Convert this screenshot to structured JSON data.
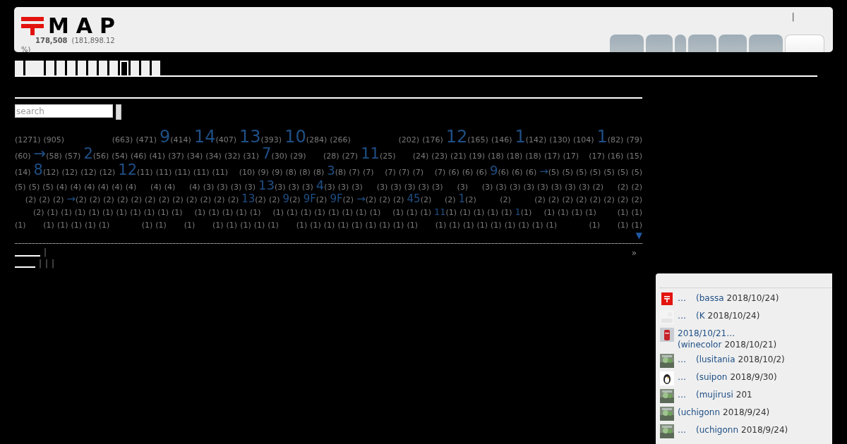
{
  "header": {
    "logo": "MAP",
    "stats": {
      "count": "178,508",
      "total": "(181,898.12",
      "percent": "%)"
    },
    "top_link": "|",
    "tabs": [
      {
        "selected": false
      },
      {
        "selected": false
      },
      {
        "selected": false
      },
      {
        "selected": false
      },
      {
        "selected": false
      },
      {
        "selected": false
      },
      {
        "selected": true
      }
    ]
  },
  "subnav": [
    {
      "selected": false
    },
    {
      "selected": false
    },
    {
      "selected": false
    },
    {
      "selected": false
    },
    {
      "selected": false
    },
    {
      "selected": false
    },
    {
      "selected": false
    },
    {
      "selected": false
    },
    {
      "selected": false
    },
    {
      "selected": true
    },
    {
      "selected": false
    },
    {
      "selected": false
    },
    {
      "selected": false
    }
  ],
  "search": {
    "placeholder": "search"
  },
  "tag_rows": [
    [
      {
        "count": "(1271)"
      },
      {
        "count": "(905)"
      },
      {
        "kind": "gap"
      },
      {
        "kind": "gap"
      },
      {
        "kind": "gap"
      },
      {
        "count": "(663)"
      },
      {
        "count": "(471)"
      },
      {
        "kind": "xl",
        "name": "9",
        "count": "(414)"
      },
      {
        "kind": "xl",
        "name": "14",
        "count": "(407)"
      },
      {
        "kind": "xl",
        "name": "13",
        "count": "(393)"
      },
      {
        "kind": "xl",
        "name": "10",
        "count": "(284)"
      },
      {
        "count": "(266)"
      },
      {
        "kind": "gap"
      },
      {
        "kind": "gap"
      },
      {
        "kind": "gap"
      },
      {
        "count": "(202)"
      },
      {
        "count": "(176)"
      },
      {
        "kind": "xl",
        "name": "12",
        "count": "(165)"
      },
      {
        "count": "(146)"
      },
      {
        "kind": "xl",
        "name": "1",
        "count": "(142)"
      },
      {
        "count": "(130)"
      },
      {
        "count": "(104)"
      },
      {
        "kind": "xl",
        "name": "1",
        "count": "(82)"
      },
      {
        "count": "(79)"
      }
    ],
    [
      {
        "count": "(60)"
      },
      {
        "kind": "l",
        "name": "→",
        "count": "(58)"
      },
      {
        "count": "(57)"
      },
      {
        "kind": "l",
        "name": "2",
        "count": "(56)"
      },
      {
        "count": "(54)"
      },
      {
        "count": "(46)"
      },
      {
        "count": "(41)"
      },
      {
        "count": "(37)"
      },
      {
        "count": "(34)"
      },
      {
        "count": "(34)"
      },
      {
        "count": "(32)"
      },
      {
        "count": "(31)"
      },
      {
        "kind": "l",
        "name": "7",
        "count": "(30)"
      },
      {
        "count": "(29)"
      },
      {
        "kind": "gap"
      },
      {
        "kind": "gap"
      },
      {
        "count": "(28)"
      },
      {
        "count": "(27)"
      },
      {
        "kind": "l",
        "name": "11",
        "count": "(25)"
      },
      {
        "kind": "gap"
      },
      {
        "kind": "gap"
      },
      {
        "count": "(24)"
      },
      {
        "count": "(23)"
      },
      {
        "count": "(21)"
      },
      {
        "count": "(19)"
      },
      {
        "count": "(18)"
      },
      {
        "count": "(18)"
      },
      {
        "count": "(18)"
      },
      {
        "count": "(17)"
      },
      {
        "count": "(17)"
      },
      {
        "kind": "gap"
      },
      {
        "count": "(17)"
      },
      {
        "count": "(16)"
      },
      {
        "count": "(15)"
      }
    ],
    [
      {
        "count": "(14)"
      },
      {
        "kind": "l",
        "name": "8",
        "count": "(12)"
      },
      {
        "count": "(12)"
      },
      {
        "count": "(12)"
      },
      {
        "count": "(12)"
      },
      {
        "kind": "l",
        "name": "12",
        "count": "(11)"
      },
      {
        "count": "(11)"
      },
      {
        "count": "(11)"
      },
      {
        "count": "(11)"
      },
      {
        "count": "(11)"
      },
      {
        "kind": "gap"
      },
      {
        "count": "(10)"
      },
      {
        "count": "(9)"
      },
      {
        "count": "(9)"
      },
      {
        "count": "(8)"
      },
      {
        "count": "(8)"
      },
      {
        "count": "(8)"
      },
      {
        "kind": "m",
        "name": "3",
        "count": "(8)"
      },
      {
        "count": "(7)"
      },
      {
        "count": "(7)"
      },
      {
        "kind": "gap"
      },
      {
        "count": "(7)"
      },
      {
        "count": "(7)"
      },
      {
        "count": "(7)"
      },
      {
        "kind": "gap"
      },
      {
        "count": "(7)"
      },
      {
        "count": "(6)"
      },
      {
        "count": "(6)"
      },
      {
        "count": "(6)"
      },
      {
        "kind": "m",
        "name": "9",
        "count": "(6)"
      },
      {
        "count": "(6)"
      },
      {
        "count": "(6)"
      },
      {
        "kind": "s",
        "name": "→",
        "count": "(5)"
      },
      {
        "count": "(5)"
      },
      {
        "count": "(5)"
      },
      {
        "count": "(5)"
      },
      {
        "count": "(5)"
      },
      {
        "count": "(5)"
      },
      {
        "count": "(5)"
      }
    ],
    [
      {
        "count": "(5)"
      },
      {
        "count": "(5)"
      },
      {
        "count": "(5)"
      },
      {
        "count": "(4)"
      },
      {
        "count": "(4)"
      },
      {
        "count": "(4)"
      },
      {
        "count": "(4)"
      },
      {
        "count": "(4)"
      },
      {
        "count": "(4)"
      },
      {
        "kind": "gap"
      },
      {
        "count": "(4)"
      },
      {
        "count": "(4)"
      },
      {
        "kind": "gap"
      },
      {
        "count": "(4)"
      },
      {
        "count": "(3)"
      },
      {
        "count": "(3)"
      },
      {
        "count": "(3)"
      },
      {
        "count": "(3)"
      },
      {
        "kind": "m",
        "name": "13",
        "count": "(3)"
      },
      {
        "count": "(3)"
      },
      {
        "count": "(3)"
      },
      {
        "kind": "m",
        "name": "4",
        "count": "(3)"
      },
      {
        "count": "(3)"
      },
      {
        "count": "(3)"
      },
      {
        "kind": "gap"
      },
      {
        "count": "(3)"
      },
      {
        "count": "(3)"
      },
      {
        "count": "(3)"
      },
      {
        "count": "(3)"
      },
      {
        "count": "(3)"
      },
      {
        "kind": "gap"
      },
      {
        "count": "(3)"
      },
      {
        "kind": "gap"
      },
      {
        "count": "(3)"
      },
      {
        "count": "(3)"
      },
      {
        "count": "(3)"
      },
      {
        "count": "(3)"
      },
      {
        "count": "(3)"
      },
      {
        "count": "(3)"
      },
      {
        "count": "(3)"
      },
      {
        "count": "(3)"
      },
      {
        "count": "(2)"
      },
      {
        "kind": "gap"
      },
      {
        "count": "(2)"
      },
      {
        "count": "(2)"
      }
    ],
    [
      {
        "kind": "gap"
      },
      {
        "count": "(2)"
      },
      {
        "count": "(2)"
      },
      {
        "count": "(2)"
      },
      {
        "kind": "s",
        "name": "→",
        "count": "(2)"
      },
      {
        "count": "(2)"
      },
      {
        "count": "(2)"
      },
      {
        "count": "(2)"
      },
      {
        "count": "(2)"
      },
      {
        "count": "(2)"
      },
      {
        "count": "(2)"
      },
      {
        "count": "(2)"
      },
      {
        "count": "(2)"
      },
      {
        "count": "(2)"
      },
      {
        "count": "(2)"
      },
      {
        "count": "(2)"
      },
      {
        "kind": "s",
        "name": "13",
        "count": "(2)"
      },
      {
        "count": "(2)"
      },
      {
        "kind": "s",
        "name": "9",
        "count": "(2)"
      },
      {
        "kind": "s",
        "name": "9F",
        "count": "(2)"
      },
      {
        "kind": "s",
        "name": "9F",
        "count": "(2)"
      },
      {
        "kind": "s",
        "name": "→",
        "count": "(2)"
      },
      {
        "count": "(2)"
      },
      {
        "count": "(2)"
      },
      {
        "kind": "s",
        "name": "45",
        "count": "(2)"
      },
      {
        "kind": "gap"
      },
      {
        "count": "(2)"
      },
      {
        "kind": "s",
        "name": "1",
        "count": "(2)"
      },
      {
        "kind": "gap"
      },
      {
        "kind": "gap"
      },
      {
        "count": "(2)"
      },
      {
        "kind": "gap"
      },
      {
        "kind": "gap"
      },
      {
        "count": "(2)"
      },
      {
        "count": "(2)"
      },
      {
        "count": "(2)"
      },
      {
        "count": "(2)"
      },
      {
        "count": "(2)"
      },
      {
        "count": "(2)"
      },
      {
        "count": "(2)"
      },
      {
        "count": "(2)"
      }
    ],
    [
      {
        "kind": "gap"
      },
      {
        "kind": "gap"
      },
      {
        "count": "(2)"
      },
      {
        "count": "(1)"
      },
      {
        "count": "(1)"
      },
      {
        "count": "(1)"
      },
      {
        "count": "(1)"
      },
      {
        "count": "(1)"
      },
      {
        "count": "(1)"
      },
      {
        "count": "(1)"
      },
      {
        "count": "(1)"
      },
      {
        "count": "(1)"
      },
      {
        "count": "(1)"
      },
      {
        "kind": "gap"
      },
      {
        "count": "(1)"
      },
      {
        "count": "(1)"
      },
      {
        "count": "(1)"
      },
      {
        "count": "(1)"
      },
      {
        "count": "(1)"
      },
      {
        "kind": "gap"
      },
      {
        "count": "(1)"
      },
      {
        "count": "(1)"
      },
      {
        "count": "(1)"
      },
      {
        "count": "(1)"
      },
      {
        "count": "(1)"
      },
      {
        "count": "(1)"
      },
      {
        "count": "(1)"
      },
      {
        "count": "(1)"
      },
      {
        "kind": "gap"
      },
      {
        "count": "(1)"
      },
      {
        "count": "(1)"
      },
      {
        "count": "(1)"
      },
      {
        "kind": "xs",
        "name": "11",
        "count": "(1)"
      },
      {
        "count": "(1)"
      },
      {
        "count": "(1)"
      },
      {
        "count": "(1)"
      },
      {
        "count": "(1)"
      },
      {
        "kind": "xs",
        "name": "1",
        "count": "(1)"
      },
      {
        "kind": "gap"
      },
      {
        "count": "(1)"
      },
      {
        "count": "(1)"
      },
      {
        "count": "(1)"
      },
      {
        "count": "(1)"
      },
      {
        "kind": "gap"
      },
      {
        "kind": "gap"
      },
      {
        "count": "(1)"
      },
      {
        "count": "(1)"
      }
    ],
    [
      {
        "count": "(1)"
      },
      {
        "kind": "gap"
      },
      {
        "count": "(1)"
      },
      {
        "count": "(1)"
      },
      {
        "count": "(1)"
      },
      {
        "count": "(1)"
      },
      {
        "count": "(1)"
      },
      {
        "kind": "gap"
      },
      {
        "kind": "gap"
      },
      {
        "count": "(1)"
      },
      {
        "count": "(1)"
      },
      {
        "kind": "gap"
      },
      {
        "count": "(1)"
      },
      {
        "kind": "gap"
      },
      {
        "count": "(1)"
      },
      {
        "count": "(1)"
      },
      {
        "count": "(1)"
      },
      {
        "count": "(1)"
      },
      {
        "count": "(1)"
      },
      {
        "kind": "gap"
      },
      {
        "count": "(1)"
      },
      {
        "count": "(1)"
      },
      {
        "count": "(1)"
      },
      {
        "count": "(1)"
      },
      {
        "count": "(1)"
      },
      {
        "count": "(1)"
      },
      {
        "count": "(1)"
      },
      {
        "count": "(1)"
      },
      {
        "count": "(1)"
      },
      {
        "kind": "gap"
      },
      {
        "count": "(1)"
      },
      {
        "count": "(1)"
      },
      {
        "count": "(1)"
      },
      {
        "count": "(1)"
      },
      {
        "count": "(1)"
      },
      {
        "count": "(1)"
      },
      {
        "count": "(1)"
      },
      {
        "count": "(1)"
      },
      {
        "count": "(1)"
      },
      {
        "kind": "gap"
      },
      {
        "kind": "gap"
      },
      {
        "count": "(1)"
      },
      {
        "kind": "gap"
      },
      {
        "count": "(1)"
      },
      {
        "count": "(1)"
      }
    ]
  ],
  "expand_toggle": "▼",
  "link_rows": [
    {
      "separators": [
        "|"
      ]
    },
    {
      "separators": [
        "|",
        "|",
        "|"
      ]
    }
  ],
  "more": "»",
  "recent": [
    {
      "kind": "postbox",
      "title": "…",
      "user": "(bassa",
      "date": "2018/10/24)"
    },
    {
      "kind": "blank",
      "title": "…",
      "user": "(K",
      "date": "2018/10/24)"
    },
    {
      "kind": "redbox",
      "title": "2018/10/21…",
      "user": "(winecolor",
      "date": "2018/10/21)"
    },
    {
      "kind": "picture",
      "title": "…",
      "user": "(lusitania",
      "date": "2018/10/2)"
    },
    {
      "kind": "penguin",
      "title": "…",
      "user": "(suipon",
      "date": "2018/9/30)"
    },
    {
      "kind": "picture",
      "title": "…",
      "user": "(mujirusi",
      "date": "201"
    },
    {
      "kind": "picture",
      "user": "(uchigonn",
      "date": "2018/9/24)"
    },
    {
      "kind": "picture",
      "title": "…",
      "user": "(uchigonn",
      "date": "2018/9/24)"
    }
  ]
}
